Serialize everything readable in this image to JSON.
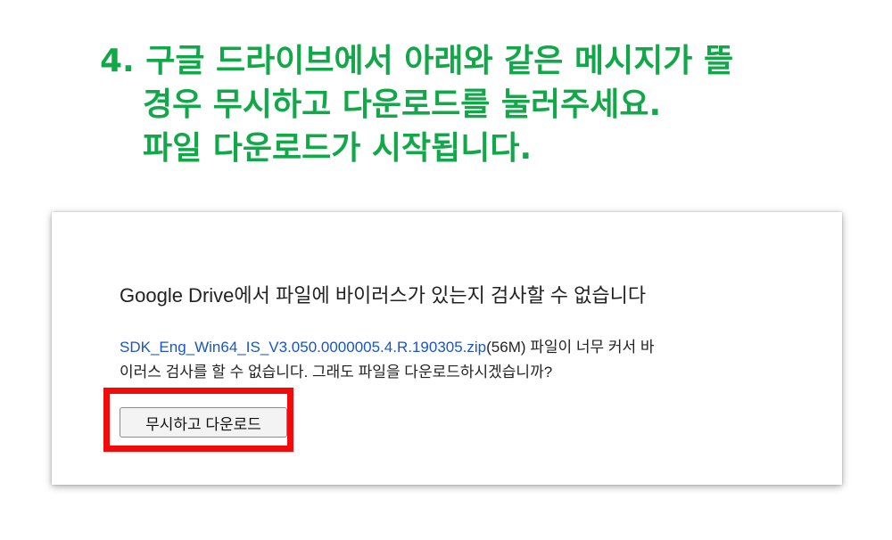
{
  "instruction": {
    "line1": "4. 구글 드라이브에서 아래와 같은 메시지가 뜰",
    "line2": "경우 무시하고 다운로드를 눌러주세요.",
    "line3": "파일 다운로드가 시작됩니다."
  },
  "dialog": {
    "title": "Google Drive에서 파일에 바이러스가 있는지 검사할 수 없습니다",
    "file_name": "SDK_Eng_Win64_IS_V3.050.0000005.4.R.190305.zip",
    "file_size": "(56M)",
    "message_line1_rest": " 파일이 너무 커서 바",
    "message_line2": "이러스 검사를 할 수 없습니다. 그래도 파일을 다운로드하시겠습니까?",
    "button_label": "무시하고 다운로드"
  },
  "colors": {
    "instruction_text": "#12a84a",
    "link": "#1a55c8",
    "highlight": "#f30a0a"
  }
}
